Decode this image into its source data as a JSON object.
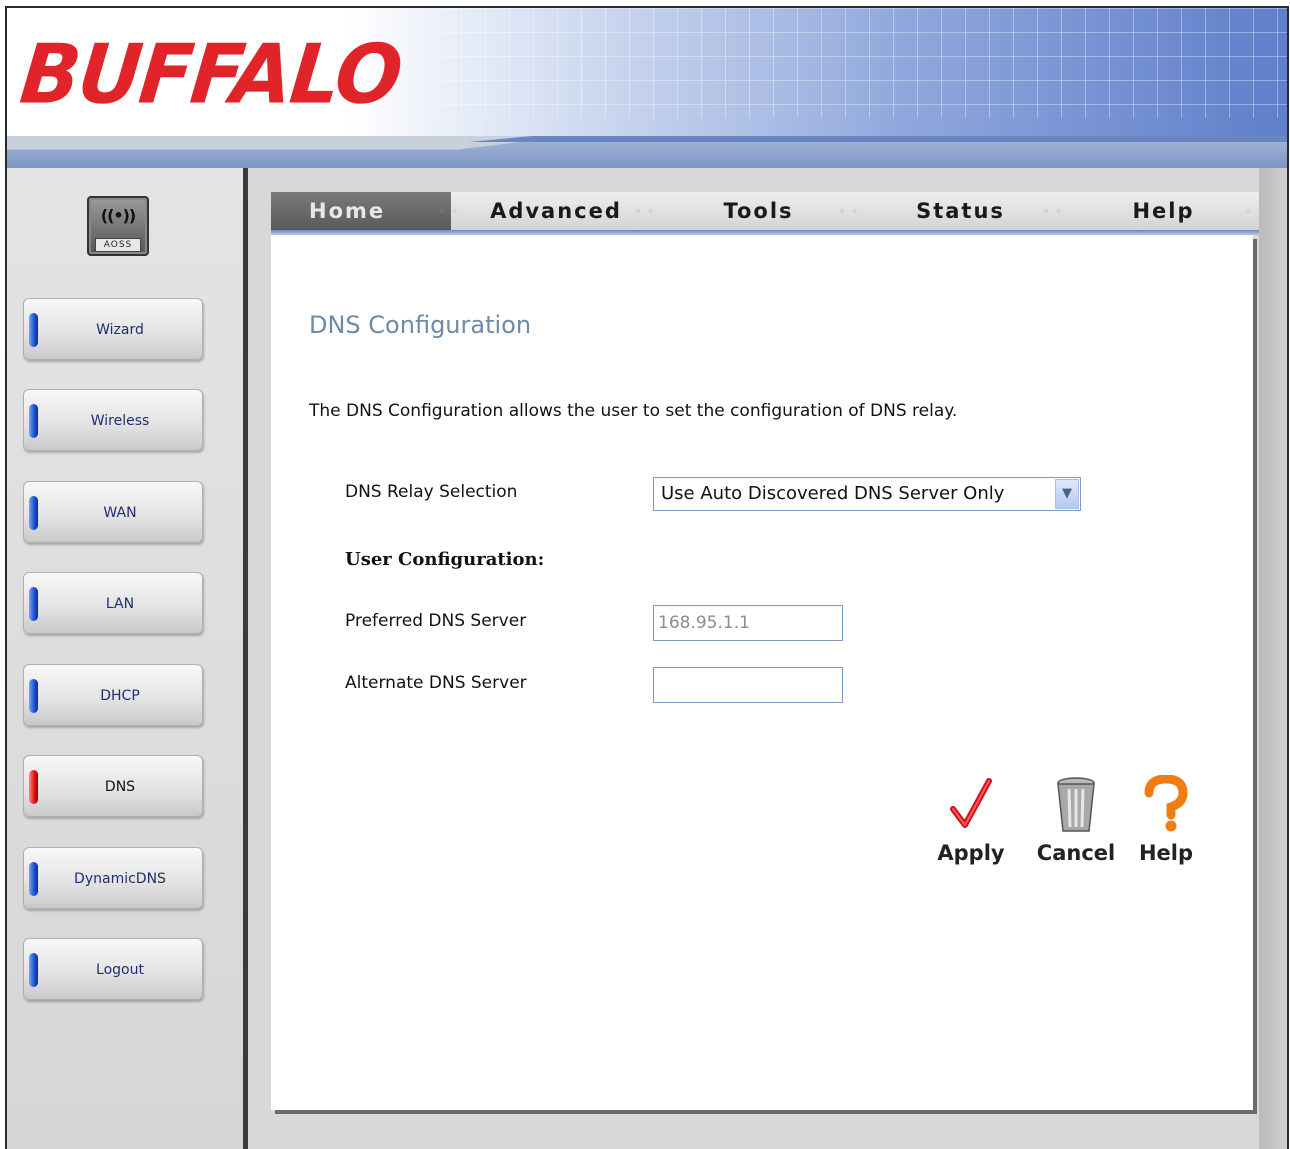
{
  "header": {
    "logo_text": "BUFFALO"
  },
  "sidebar": {
    "aoss_label": "AOSS",
    "items": [
      {
        "label": "Wizard",
        "active": false
      },
      {
        "label": "Wireless",
        "active": false
      },
      {
        "label": "WAN",
        "active": false
      },
      {
        "label": "LAN",
        "active": false
      },
      {
        "label": "DHCP",
        "active": false
      },
      {
        "label": "DNS",
        "active": true
      },
      {
        "label": "DynamicDNS",
        "active": false
      },
      {
        "label": "Logout",
        "active": false
      }
    ]
  },
  "tabs": [
    {
      "label": "Home",
      "active": true
    },
    {
      "label": "Advanced",
      "active": false
    },
    {
      "label": "Tools",
      "active": false
    },
    {
      "label": "Status",
      "active": false
    },
    {
      "label": "Help",
      "active": false
    }
  ],
  "main": {
    "title": "DNS Configuration",
    "description": "The DNS Configuration allows the user to set the configuration of DNS relay.",
    "dns_relay": {
      "label": "DNS Relay Selection",
      "selected": "Use Auto Discovered DNS Server Only"
    },
    "user_config_heading": "User Configuration:",
    "preferred_dns": {
      "label": "Preferred DNS Server",
      "value": "168.95.1.1"
    },
    "alternate_dns": {
      "label": "Alternate DNS Server",
      "value": ""
    },
    "actions": {
      "apply": "Apply",
      "cancel": "Cancel",
      "help": "Help"
    }
  },
  "colors": {
    "logo_red": "#e0242a",
    "title_blue": "#6e8aa6",
    "active_pill_red": "#e31414",
    "pill_blue": "#1f4fd4"
  }
}
